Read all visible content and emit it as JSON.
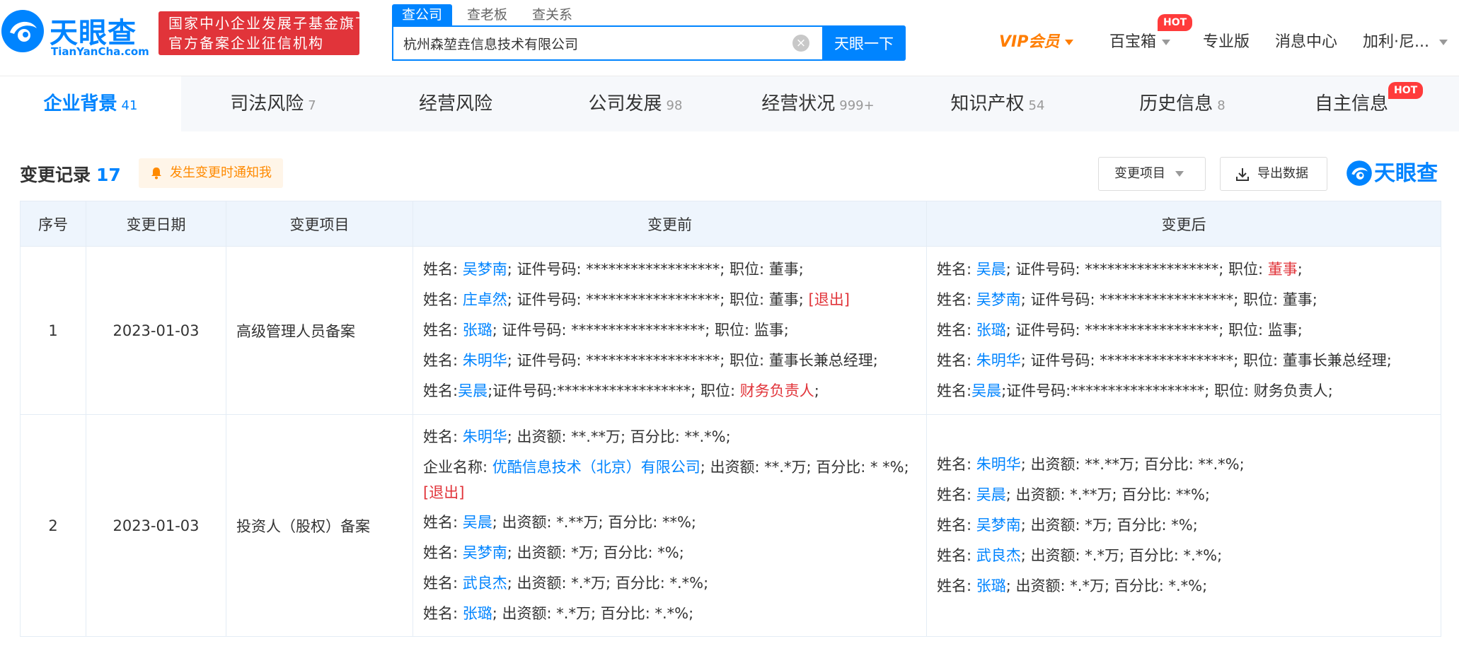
{
  "header": {
    "logo_cn": "天眼查",
    "logo_en": "TianYanCha.com",
    "gov_badge_line1": "国家中小企业发展子基金旗下",
    "gov_badge_line2": "官方备案企业征信机构",
    "search_tabs": [
      "查公司",
      "查老板",
      "查关系"
    ],
    "search_value": "杭州森堃垚信息技术有限公司",
    "search_button": "天眼一下",
    "nav": {
      "vip": "VIP会员",
      "baobaoxiang": "百宝箱",
      "hot": "HOT",
      "pro": "专业版",
      "messages": "消息中心",
      "user": "加利·尼..."
    }
  },
  "category_tabs": [
    {
      "label": "企业背景",
      "count": "41"
    },
    {
      "label": "司法风险",
      "count": "7"
    },
    {
      "label": "经营风险",
      "count": ""
    },
    {
      "label": "公司发展",
      "count": "98"
    },
    {
      "label": "经营状况",
      "count": "999+"
    },
    {
      "label": "知识产权",
      "count": "54"
    },
    {
      "label": "历史信息",
      "count": "8"
    },
    {
      "label": "自主信息",
      "count": "",
      "badge": "HOT"
    }
  ],
  "section": {
    "title": "变更记录",
    "count": "17",
    "notify": "发生变更时通知我",
    "filter": "变更项目",
    "export": "导出数据",
    "watermark": "天眼查"
  },
  "table": {
    "headers": [
      "序号",
      "变更日期",
      "变更项目",
      "变更前",
      "变更后"
    ],
    "rows": [
      {
        "index": "1",
        "date": "2023-01-03",
        "item": "高级管理人员备案",
        "before": [
          {
            "pre": "姓名: ",
            "name": "吴梦南",
            "mid": "; 证件号码: ******************; 职位: ",
            "role": "董事",
            "role_red": false,
            "post": ";",
            "tag": ""
          },
          {
            "pre": "姓名: ",
            "name": "庄卓然",
            "mid": "; 证件号码: ******************; 职位: ",
            "role": "董事",
            "role_red": false,
            "post": "; ",
            "tag": "[退出]"
          },
          {
            "pre": "姓名: ",
            "name": "张璐",
            "mid": "; 证件号码: ******************; 职位: ",
            "role": "监事",
            "role_red": false,
            "post": ";",
            "tag": ""
          },
          {
            "pre": "姓名: ",
            "name": "朱明华",
            "mid": "; 证件号码: ******************; 职位: ",
            "role": "董事长兼总经理",
            "role_red": false,
            "post": ";",
            "tag": ""
          },
          {
            "pre": "姓名:",
            "name": "吴晨",
            "mid": ";证件号码:******************; 职位: ",
            "role": "财务负责人",
            "role_red": true,
            "post": ";",
            "tag": ""
          }
        ],
        "after": [
          {
            "pre": "姓名: ",
            "name": "吴晨",
            "mid": "; 证件号码: ******************; 职位: ",
            "role": "董事",
            "role_red": true,
            "post": ";",
            "tag": ""
          },
          {
            "pre": "姓名: ",
            "name": "吴梦南",
            "mid": "; 证件号码: ******************; 职位: ",
            "role": "董事",
            "role_red": false,
            "post": ";",
            "tag": ""
          },
          {
            "pre": "姓名: ",
            "name": "张璐",
            "mid": "; 证件号码: ******************; 职位: ",
            "role": "监事",
            "role_red": false,
            "post": ";",
            "tag": ""
          },
          {
            "pre": "姓名: ",
            "name": "朱明华",
            "mid": "; 证件号码: ******************; 职位: ",
            "role": "董事长兼总经理",
            "role_red": false,
            "post": ";",
            "tag": ""
          },
          {
            "pre": "姓名:",
            "name": "吴晨",
            "mid": ";证件号码:******************; 职位: ",
            "role": "财务负责人",
            "role_red": false,
            "post": ";",
            "tag": ""
          }
        ]
      },
      {
        "index": "2",
        "date": "2023-01-03",
        "item": "投资人（股权）备案",
        "before": [
          {
            "pre": "姓名: ",
            "name": "朱明华",
            "mid": "; 出资额: **.**万; 百分比: **.*%;",
            "tag": ""
          },
          {
            "pre": "企业名称: ",
            "name": "优酷信息技术（北京）有限公司",
            "mid": "; 出资额: **.*万; 百分比: *\n*%; ",
            "tag": "[退出]",
            "wrap": true
          },
          {
            "pre": "姓名: ",
            "name": "吴晨",
            "mid": "; 出资额: *.**万; 百分比: **%;",
            "tag": ""
          },
          {
            "pre": "姓名: ",
            "name": "吴梦南",
            "mid": "; 出资额: *万; 百分比: *%;",
            "tag": ""
          },
          {
            "pre": "姓名: ",
            "name": "武良杰",
            "mid": "; 出资额: *.*万; 百分比: *.*%;",
            "tag": ""
          },
          {
            "pre": "姓名: ",
            "name": "张璐",
            "mid": "; 出资额: *.*万; 百分比: *.*%;",
            "tag": ""
          }
        ],
        "after": [
          {
            "pre": "姓名: ",
            "name": "朱明华",
            "mid": "; 出资额: **.**万; 百分比: **.*%;",
            "tag": ""
          },
          {
            "pre": "姓名: ",
            "name": "吴晨",
            "mid": "; 出资额: *.**万; 百分比: **%;",
            "tag": ""
          },
          {
            "pre": "姓名: ",
            "name": "吴梦南",
            "mid": "; 出资额: *万; 百分比: *%;",
            "tag": ""
          },
          {
            "pre": "姓名: ",
            "name": "武良杰",
            "mid": "; 出资额: *.*万; 百分比: *.*%;",
            "tag": ""
          },
          {
            "pre": "姓名: ",
            "name": "张璐",
            "mid": "; 出资额: *.*万; 百分比: *.*%;",
            "tag": ""
          }
        ]
      }
    ]
  },
  "colors": {
    "brand": "#0084ff",
    "red": "#e1343a",
    "orange": "#ff7d00"
  },
  "icons": [
    "clear-icon",
    "bell-icon",
    "download-icon",
    "caret-down-icon",
    "tianyancha-logo-icon"
  ]
}
